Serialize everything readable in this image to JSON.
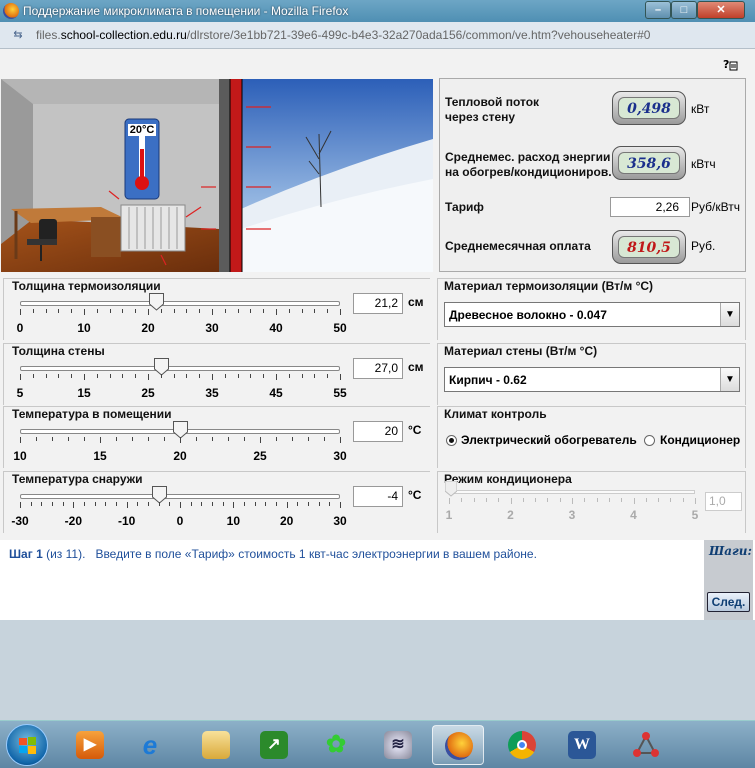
{
  "window": {
    "title": "Поддержание микроклимата в помещении - Mozilla Firefox",
    "url_prefix": "files.",
    "url_domain": "school-collection.edu.ru",
    "url_path": "/dlrstore/3e1bb721-39e6-499c-b4e3-32a270ada156/common/ve.htm?vehouseheater#0",
    "minimize_glyph": "–",
    "maximize_glyph": "□",
    "close_glyph": "✕"
  },
  "scene": {
    "room_temperature_label": "20°C"
  },
  "info": {
    "heat_flow_label": "Тепловой поток\nчерез стену",
    "heat_flow_value": "0,498",
    "heat_flow_unit": "кВт",
    "energy_label": "Среднемес. расход энергии\nна обогрев/кондициониров.",
    "energy_value": "358,6",
    "energy_unit": "кВтч",
    "tariff_label": "Тариф",
    "tariff_value": "2,26",
    "tariff_unit": "Руб/кВтч",
    "payment_label": "Среднемесячная оплата",
    "payment_value": "810,5",
    "payment_unit": "Руб.",
    "colors": {
      "heat_flow": "#1a2f8c",
      "energy": "#1a2f8c",
      "payment": "#c01818"
    }
  },
  "sliders": [
    {
      "label": "Толщина термоизоляции",
      "value": "21,2",
      "unit": "см",
      "min": 0,
      "max": 50,
      "current": 21.2,
      "ticks": [
        "0",
        "10",
        "20",
        "30",
        "40",
        "50"
      ]
    },
    {
      "label": "Толщина стены",
      "value": "27,0",
      "unit": "см",
      "min": 5,
      "max": 55,
      "current": 27,
      "ticks": [
        "5",
        "15",
        "25",
        "35",
        "45",
        "55"
      ]
    },
    {
      "label": "Температура в помещении",
      "value": "20",
      "unit": "°C",
      "min": 10,
      "max": 30,
      "current": 20,
      "ticks": [
        "10",
        "15",
        "20",
        "25",
        "30"
      ]
    },
    {
      "label": "Температура снаружи",
      "value": "-4",
      "unit": "°C",
      "min": -30,
      "max": 30,
      "current": -4,
      "ticks": [
        "-30",
        "-20",
        "-10",
        "0",
        "10",
        "20",
        "30"
      ]
    }
  ],
  "insulation_material": {
    "label": "Материал термоизоляции (Вт/м °C)",
    "selected": "Древесное волокно - 0.047"
  },
  "wall_material": {
    "label": "Материал стены (Вт/м °C)",
    "selected": "Кирпич - 0.62"
  },
  "climate_control": {
    "label": "Климат контроль",
    "option_heater": "Электрический обогреватель",
    "option_ac": "Кондиционер",
    "selected": "heater"
  },
  "ac_mode": {
    "label": "Режим кондиционера",
    "value": "1,0",
    "current": 1,
    "min": 1,
    "max": 5,
    "ticks": [
      "1",
      "2",
      "3",
      "4",
      "5"
    ]
  },
  "step": {
    "step_label": "Шаг 1",
    "step_count": "(из 11).",
    "instruction": "Введите в поле «Тариф» стоимость 1 квт-час электроэнергии в вашем районе.",
    "steps_title": "Шаги:",
    "next_label": "След."
  },
  "taskbar": {
    "apps": [
      "media-player",
      "internet-explorer",
      "file-explorer",
      "stock-app",
      "icq",
      "network",
      "firefox",
      "chrome",
      "word",
      "network-tool"
    ],
    "word_letter": "W",
    "active_app": "firefox"
  }
}
